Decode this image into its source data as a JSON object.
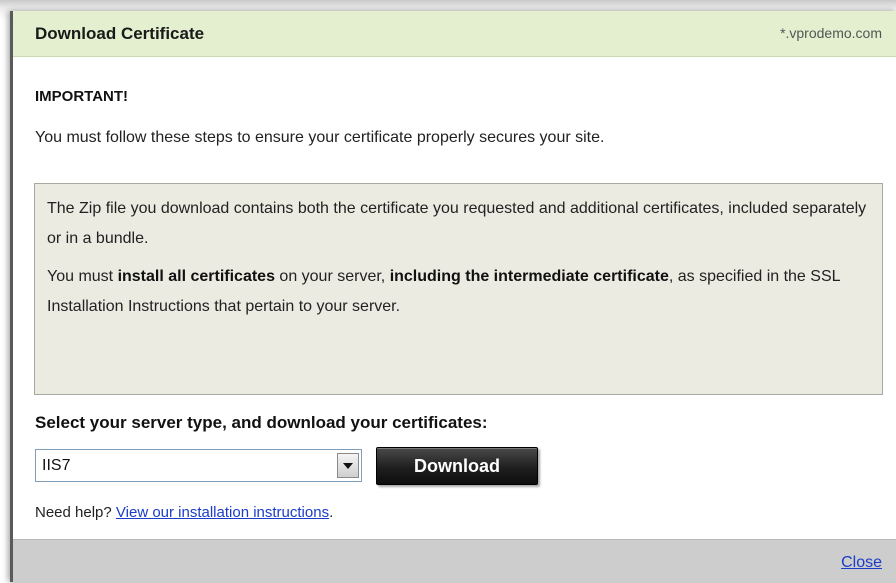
{
  "dialog": {
    "title": "Download Certificate",
    "domain": "*.vprodemo.com"
  },
  "content": {
    "important_heading": "IMPORTANT!",
    "intro": "You must follow these steps to ensure your certificate properly secures your site.",
    "notice": {
      "para1": "The Zip file you download contains both the certificate you requested and additional certificates, included separately or in a bundle.",
      "para2_before": "You must ",
      "para2_bold1": "install all certificates",
      "para2_mid": " on your server, ",
      "para2_bold2": "including the intermediate certificate",
      "para2_after": ", as specified in the SSL Installation Instructions that pertain to your server."
    },
    "select_label": "Select your server type, and download your certificates:",
    "server_type": {
      "selected": "IIS7",
      "arrow_icon": "chevron-down-icon"
    },
    "download_label": "Download",
    "help_prefix": "Need help? ",
    "help_link": "View our installation instructions",
    "help_suffix": "."
  },
  "footer": {
    "close_label": "Close"
  },
  "colors": {
    "title_bar": "#e3efcf",
    "notice_bg": "#ebebe1",
    "footer_bg": "#cdcdcd",
    "link": "#1a3cc8",
    "button": "#1f1f1f"
  }
}
